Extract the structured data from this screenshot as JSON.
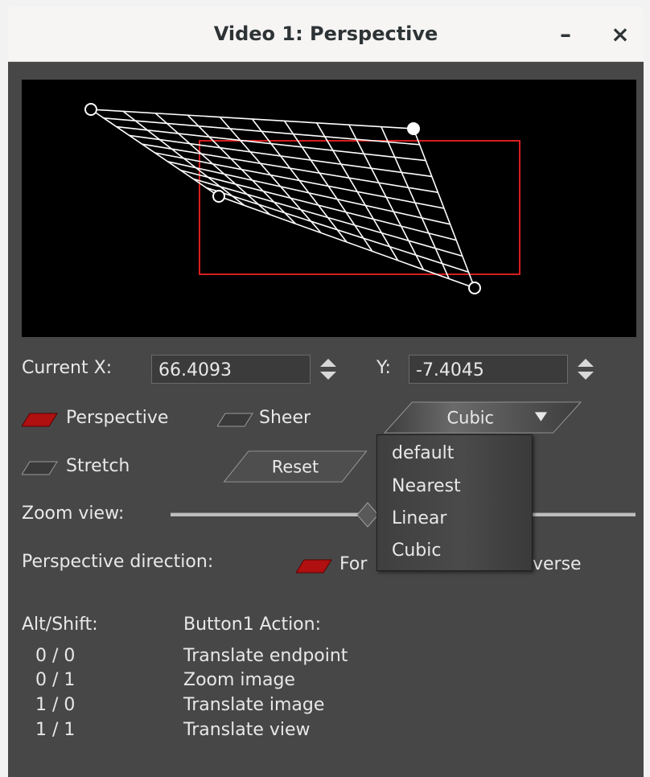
{
  "window": {
    "title": "Video 1: Perspective",
    "minimize": "–",
    "close": "×"
  },
  "coords": {
    "x_label": "Current X:",
    "x_value": "66.4093",
    "y_label": "Y:",
    "y_value": "-7.4045"
  },
  "modes": {
    "perspective": {
      "label": "Perspective",
      "checked": true
    },
    "sheer": {
      "label": "Sheer",
      "checked": false
    },
    "stretch": {
      "label": "Stretch",
      "checked": false
    }
  },
  "interpolation": {
    "selected": "Cubic",
    "options": [
      "default",
      "Nearest",
      "Linear",
      "Cubic"
    ]
  },
  "reset_label": "Reset",
  "zoom": {
    "label": "Zoom view:"
  },
  "direction": {
    "label": "Perspective direction:",
    "forward_visible": "For",
    "reverse_visible": "verse"
  },
  "help": {
    "col1_header": "Alt/Shift:",
    "col2_header": "Button1 Action:",
    "rows": [
      {
        "keys": "0 / 0",
        "action": "Translate endpoint"
      },
      {
        "keys": "0 / 1",
        "action": "Zoom image"
      },
      {
        "keys": "1 / 0",
        "action": "Translate image"
      },
      {
        "keys": "1 / 1",
        "action": "Translate view"
      }
    ]
  },
  "colors": {
    "accent": "#b01010",
    "panel": "#474747",
    "frame_outline": "#d81e1e"
  }
}
